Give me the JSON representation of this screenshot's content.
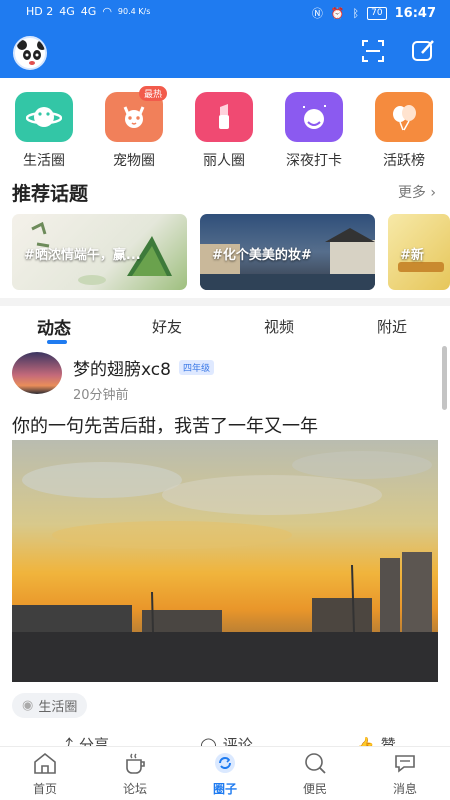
{
  "status_bar": {
    "carrier1": "HD 2",
    "net1": "4G",
    "net2": "4G",
    "speed": "90.4 K/s",
    "battery": "70",
    "time": "16:47"
  },
  "header": {
    "avatar_icon": "panda-avatar",
    "scan_icon": "scan-icon",
    "compose_icon": "compose-icon",
    "color": "#1f7bf0"
  },
  "categories": [
    {
      "label": "生活圈",
      "icon": "planet-icon",
      "color": "#2cc4a0",
      "badge": ""
    },
    {
      "label": "宠物圈",
      "icon": "cat-icon",
      "color": "#f07b52",
      "badge": "最热"
    },
    {
      "label": "丽人圈",
      "icon": "lipstick-icon",
      "color": "#f0476e",
      "badge": ""
    },
    {
      "label": "深夜打卡",
      "icon": "moon-face-icon",
      "color": "#8a55f0",
      "badge": ""
    },
    {
      "label": "活跃榜",
      "icon": "balloon-icon",
      "color": "#f5893a",
      "badge": ""
    }
  ],
  "recommended": {
    "title": "推荐话题",
    "more": "更多",
    "topics": [
      {
        "caption": "#晒浓情端午，赢..."
      },
      {
        "caption": "#化个美美的妆#"
      },
      {
        "caption": "#新"
      }
    ]
  },
  "tabs": [
    "动态",
    "好友",
    "视频",
    "附近"
  ],
  "post": {
    "username": "梦的翅膀xc8",
    "grade": "四年级",
    "time": "20分钟前",
    "text": "你的一句先苦后甜，我苦了一年又一年",
    "circle_tag": "生活圈",
    "actions": {
      "share": "分享",
      "comment": "评论",
      "like": "赞"
    }
  },
  "bottom_nav": [
    {
      "label": "首页",
      "icon": "home-icon",
      "active": false
    },
    {
      "label": "论坛",
      "icon": "coffee-icon",
      "active": false
    },
    {
      "label": "圈子",
      "icon": "circle-refresh-icon",
      "active": true
    },
    {
      "label": "便民",
      "icon": "search-service-icon",
      "active": false
    },
    {
      "label": "消息",
      "icon": "message-icon",
      "active": false
    }
  ]
}
